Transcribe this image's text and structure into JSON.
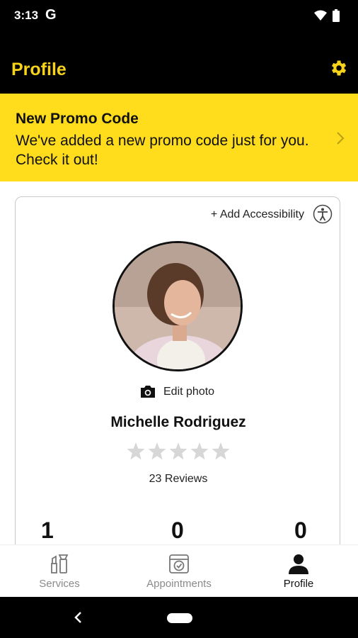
{
  "status": {
    "time": "3:13",
    "g_label": "G"
  },
  "header": {
    "title": "Profile",
    "settings_icon": "gear-icon",
    "accent": "#f7d21b"
  },
  "promo": {
    "title": "New Promo Code",
    "body": "We've added a new promo code just for you. Check it out!",
    "background": "#ffdc1c"
  },
  "profile": {
    "add_accessibility_label": "+ Add Accessibility",
    "edit_photo_label": "Edit photo",
    "name": "Michelle Rodriguez",
    "rating": 0,
    "rating_max": 5,
    "reviews_label": "23 Reviews",
    "stats": [
      "1",
      "0",
      "0"
    ]
  },
  "nav": {
    "items": [
      {
        "label": "Services",
        "icon": "services-icon"
      },
      {
        "label": "Appointments",
        "icon": "appointments-icon"
      },
      {
        "label": "Profile",
        "icon": "profile-icon"
      }
    ],
    "active": "Profile"
  }
}
